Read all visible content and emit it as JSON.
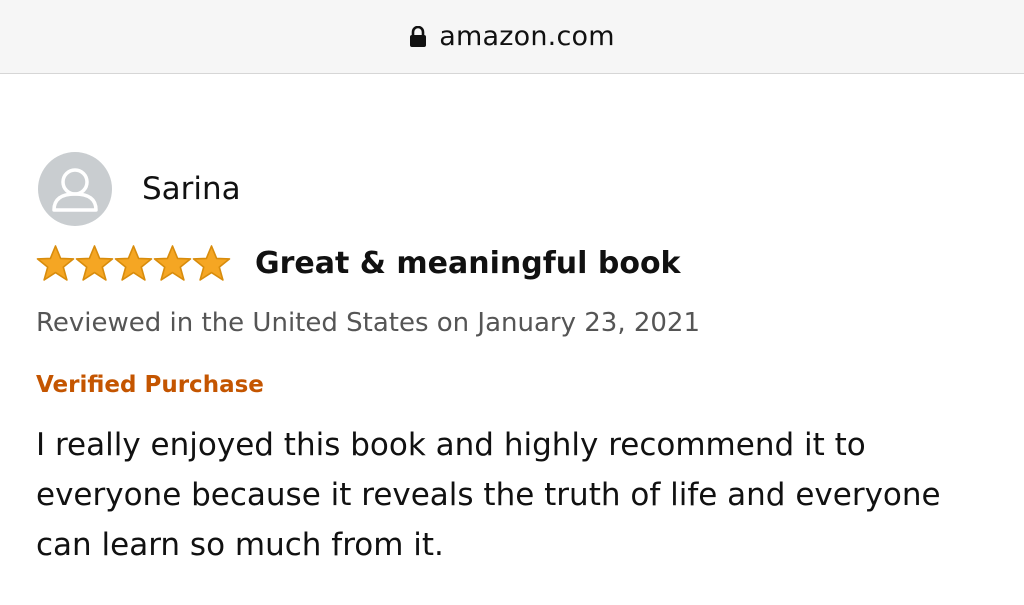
{
  "browser": {
    "url": "amazon.com",
    "lock_icon": "lock-icon"
  },
  "review": {
    "reviewer_name": "Sarina",
    "avatar_icon": "user-avatar-icon",
    "rating": 5,
    "rating_max": 5,
    "star_color": "#f5a623",
    "title": "Great & meaningful book",
    "meta": "Reviewed in the United States on January 23, 2021",
    "verified_label": "Verified Purchase",
    "verified_color": "#c45500",
    "body": "I really enjoyed this book and highly recommend it to everyone because it reveals the truth of life and everyone can learn so much from it."
  }
}
